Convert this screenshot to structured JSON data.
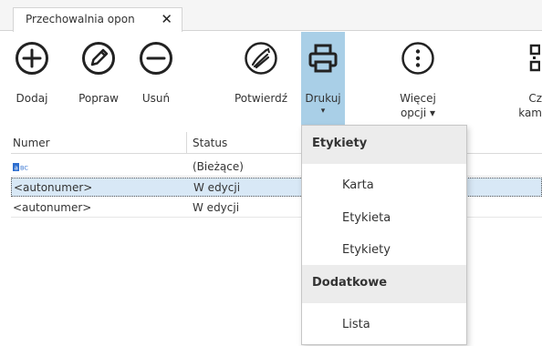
{
  "tab": {
    "title": "Przechowalnia opon",
    "close": "✕"
  },
  "toolbar": {
    "add": "Dodaj",
    "edit": "Popraw",
    "delete": "Usuń",
    "confirm": "Potwierdź",
    "print": "Drukuj",
    "print_arrow": "▾",
    "more_line1": "Więcej",
    "more_line2": "opcji ▾",
    "cut_line1": "Cz",
    "cut_line2": "kam"
  },
  "grid": {
    "columns": [
      "Numer",
      "Status"
    ],
    "rows": [
      {
        "number": "",
        "status": "(Bieżące)"
      },
      {
        "number": "<autonumer>",
        "status": "W edycji"
      },
      {
        "number": "<autonumer>",
        "status": "W edycji"
      }
    ]
  },
  "print_menu": {
    "sections": [
      {
        "header": "Etykiety",
        "items": [
          "Karta",
          "Etykieta",
          "Etykiety"
        ]
      },
      {
        "header": "Dodatkowe",
        "items": [
          "Lista"
        ]
      }
    ]
  },
  "colors": {
    "accent": "#a9cfe7",
    "selected_row": "#d8e8f6",
    "menu_header": "#ececec"
  }
}
